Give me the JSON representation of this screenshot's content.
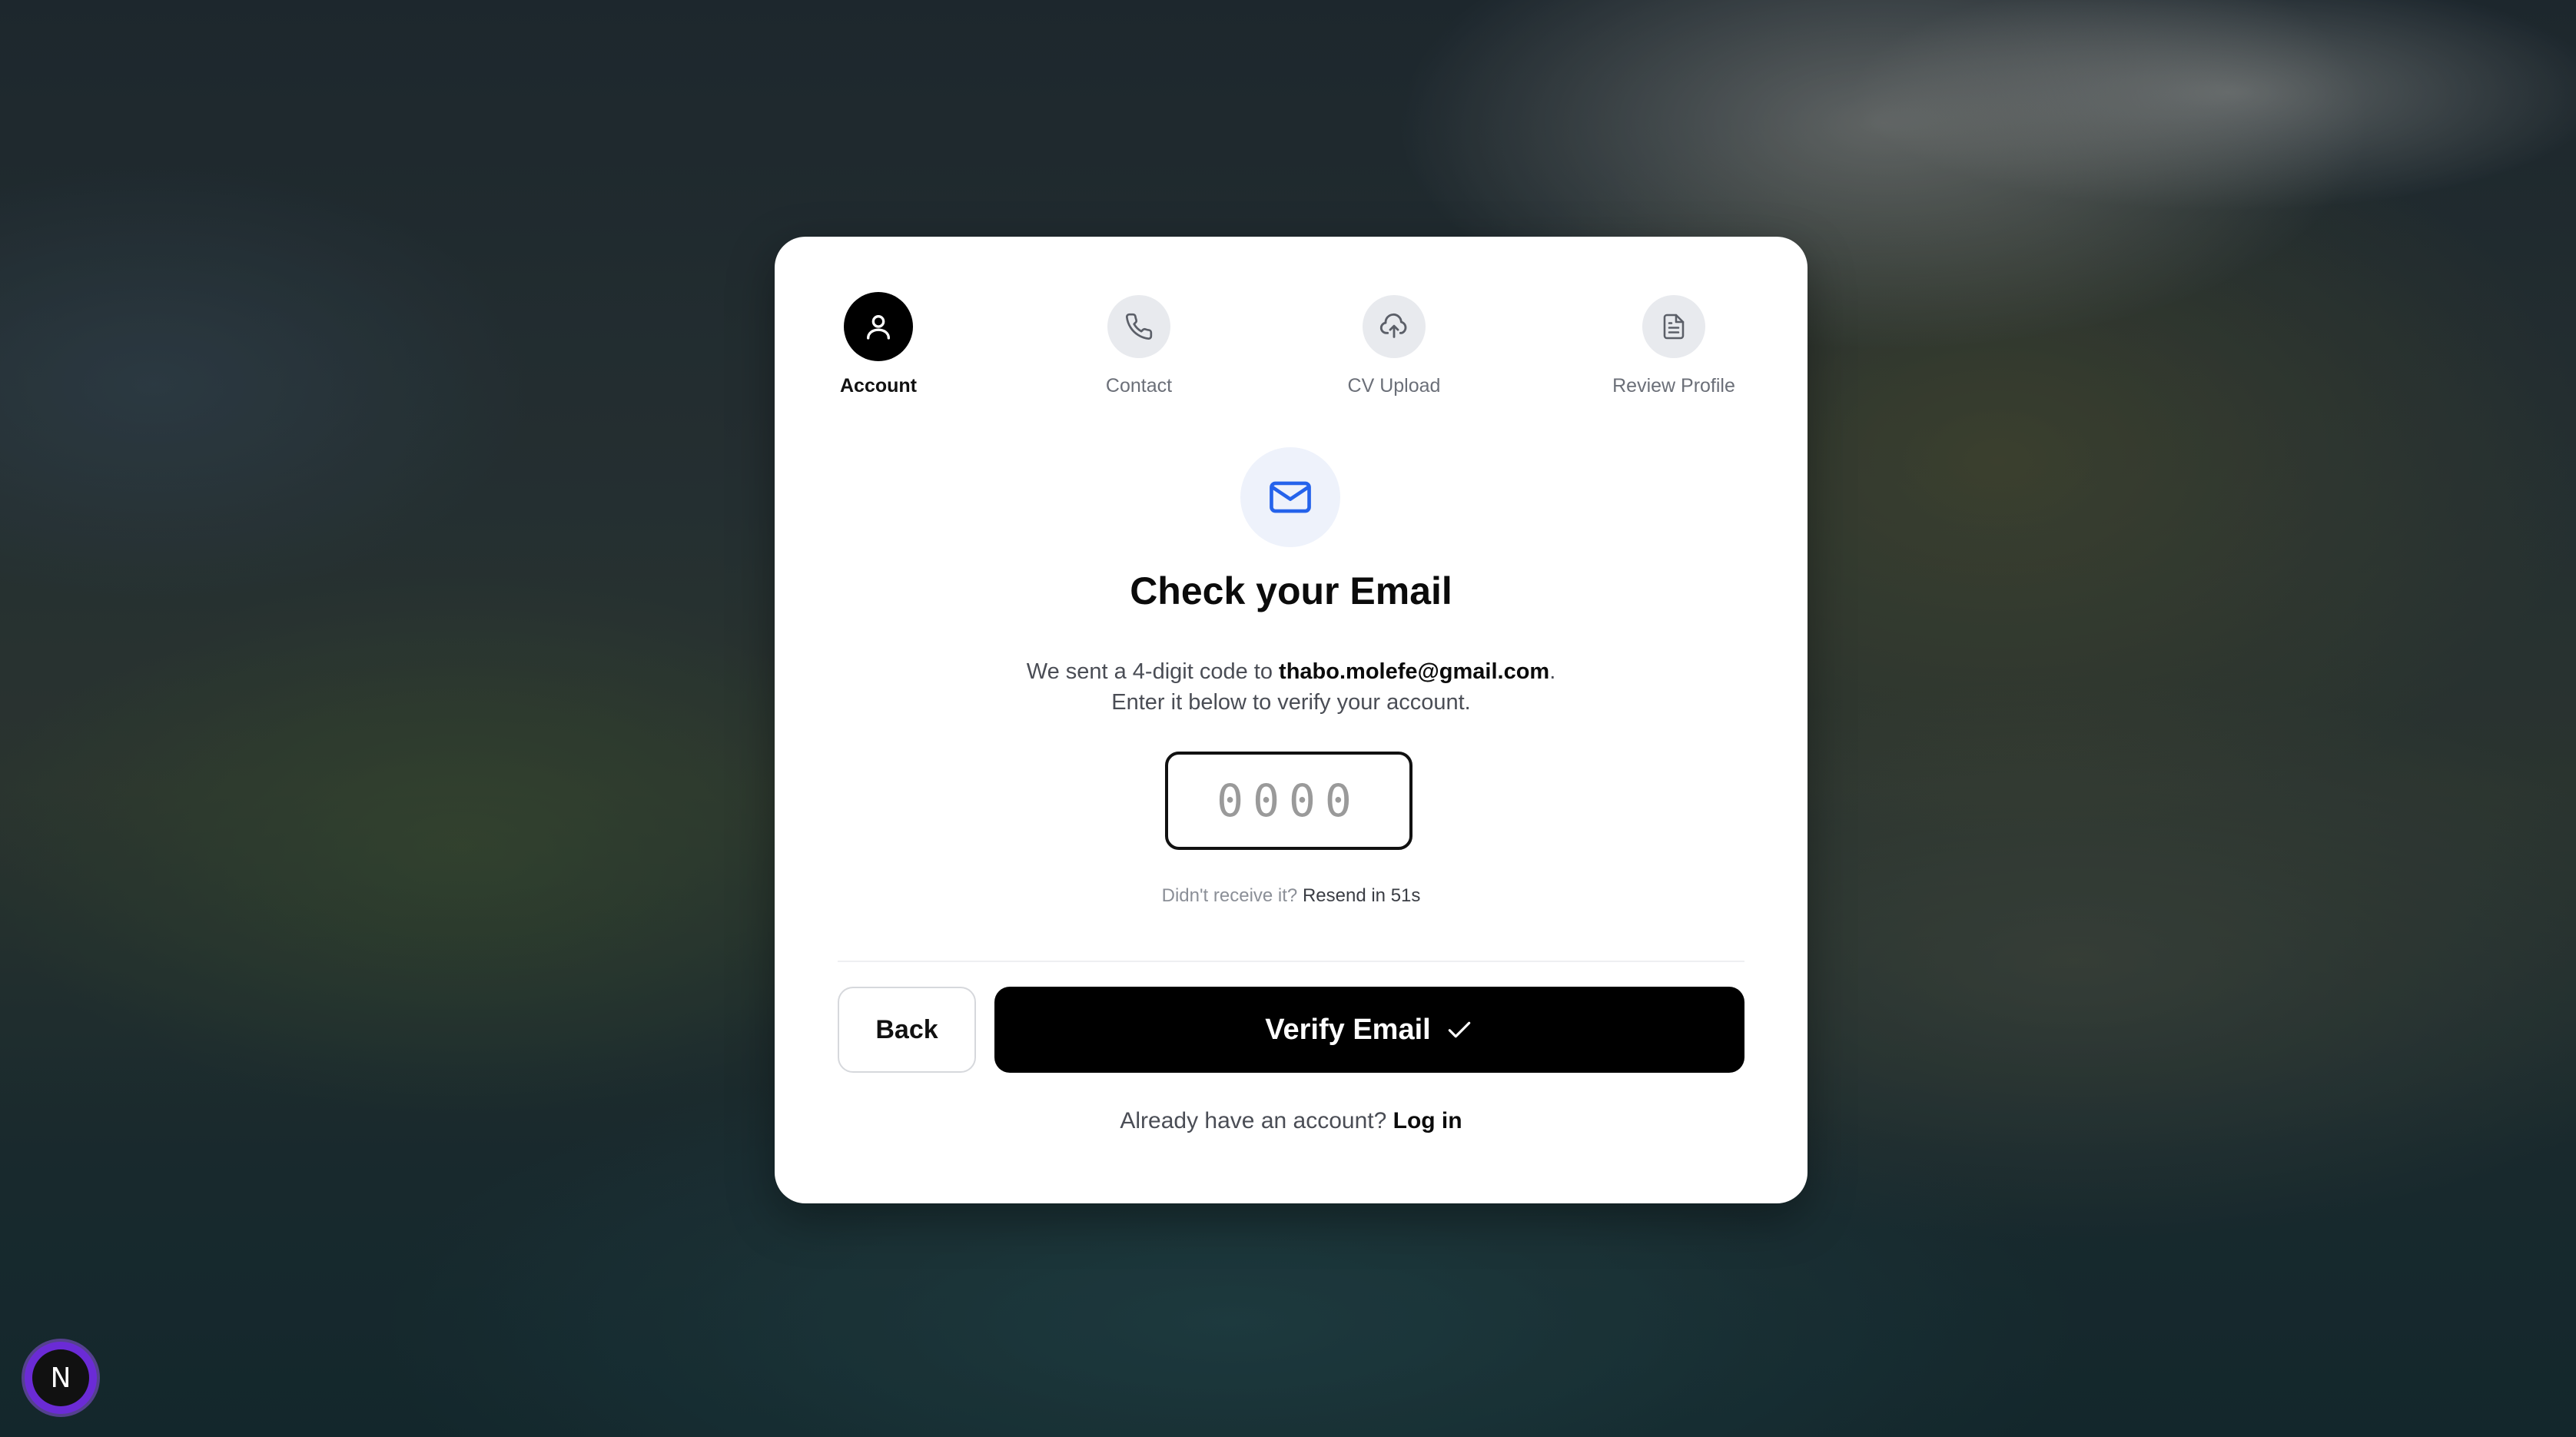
{
  "steps": [
    {
      "label": "Account",
      "icon": "user-icon",
      "active": true
    },
    {
      "label": "Contact",
      "icon": "phone-icon",
      "active": false
    },
    {
      "label": "CV Upload",
      "icon": "cloud-upload-icon",
      "active": false
    },
    {
      "label": "Review Profile",
      "icon": "document-icon",
      "active": false
    }
  ],
  "verify": {
    "title": "Check your Email",
    "desc_prefix": "We sent a 4-digit code to ",
    "email": "thabo.molefe@gmail.com",
    "desc_suffix": ".",
    "desc_line2": "Enter it below to verify your account.",
    "code_placeholder": "0000",
    "resend_prompt": "Didn't receive it?",
    "resend_countdown": "Resend in 51s"
  },
  "actions": {
    "back_label": "Back",
    "verify_label": "Verify Email"
  },
  "footer": {
    "prompt": "Already have an account?",
    "login_label": "Log in"
  },
  "badge": {
    "letter": "N"
  },
  "colors": {
    "accent": "#2563eb",
    "primary": "#000000",
    "badge": "#6b2bd6"
  }
}
